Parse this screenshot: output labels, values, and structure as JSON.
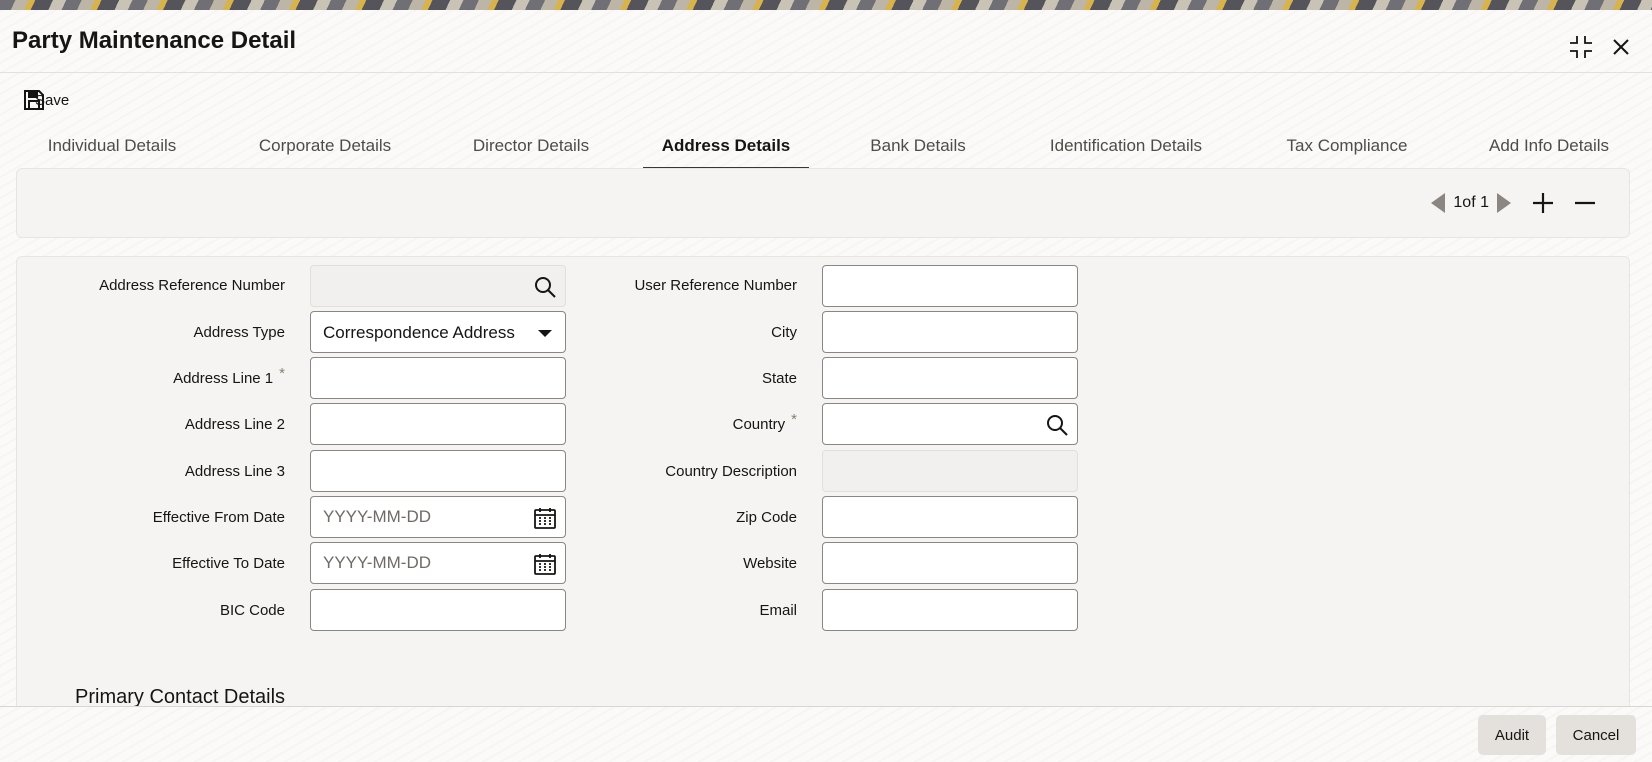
{
  "window": {
    "title": "Party Maintenance Detail",
    "maximize_icon": "collapse-arrows-icon",
    "close_icon": "close-icon"
  },
  "toolbar": {
    "save_label": "Save",
    "save_icon": "floppy-disk-icon"
  },
  "tabs": [
    {
      "label": "Individual Details",
      "active": false
    },
    {
      "label": "Corporate Details",
      "active": false
    },
    {
      "label": "Director Details",
      "active": false
    },
    {
      "label": "Address Details",
      "active": true
    },
    {
      "label": "Bank Details",
      "active": false
    },
    {
      "label": "Identification Details",
      "active": false
    },
    {
      "label": "Tax Compliance",
      "active": false
    },
    {
      "label": "Add Info Details",
      "active": false
    }
  ],
  "pager": {
    "current": 1,
    "total": 1,
    "text": "1of 1",
    "prev_icon": "triangle-left-icon",
    "next_icon": "triangle-right-icon",
    "add_icon": "plus-icon",
    "remove_icon": "minus-icon"
  },
  "form": {
    "left": [
      {
        "label": "Address Reference Number",
        "value": "",
        "required": false,
        "icon": "search-icon",
        "readonly": true
      },
      {
        "label": "Address Type",
        "value": "Correspondence Address",
        "required": false,
        "icon": "caret-down-icon"
      },
      {
        "label": "Address Line 1",
        "value": "",
        "required": true
      },
      {
        "label": "Address Line 2",
        "value": ""
      },
      {
        "label": "Address Line 3",
        "value": ""
      },
      {
        "label": "Effective From Date",
        "value": "",
        "placeholder": "YYYY-MM-DD",
        "icon": "calendar-icon"
      },
      {
        "label": "Effective To Date",
        "value": "",
        "placeholder": "YYYY-MM-DD",
        "icon": "calendar-icon"
      },
      {
        "label": "BIC Code",
        "value": ""
      }
    ],
    "right": [
      {
        "label": "User Reference Number",
        "value": ""
      },
      {
        "label": "City",
        "value": ""
      },
      {
        "label": "State",
        "value": ""
      },
      {
        "label": "Country",
        "value": "",
        "required": true,
        "icon": "search-icon"
      },
      {
        "label": "Country Description",
        "value": "",
        "readonly": true
      },
      {
        "label": "Zip Code",
        "value": ""
      },
      {
        "label": "Website",
        "value": ""
      },
      {
        "label": "Email",
        "value": ""
      }
    ],
    "required_marker": "*",
    "section_title": "Primary Contact Details"
  },
  "footer": {
    "audit_label": "Audit",
    "cancel_label": "Cancel"
  }
}
